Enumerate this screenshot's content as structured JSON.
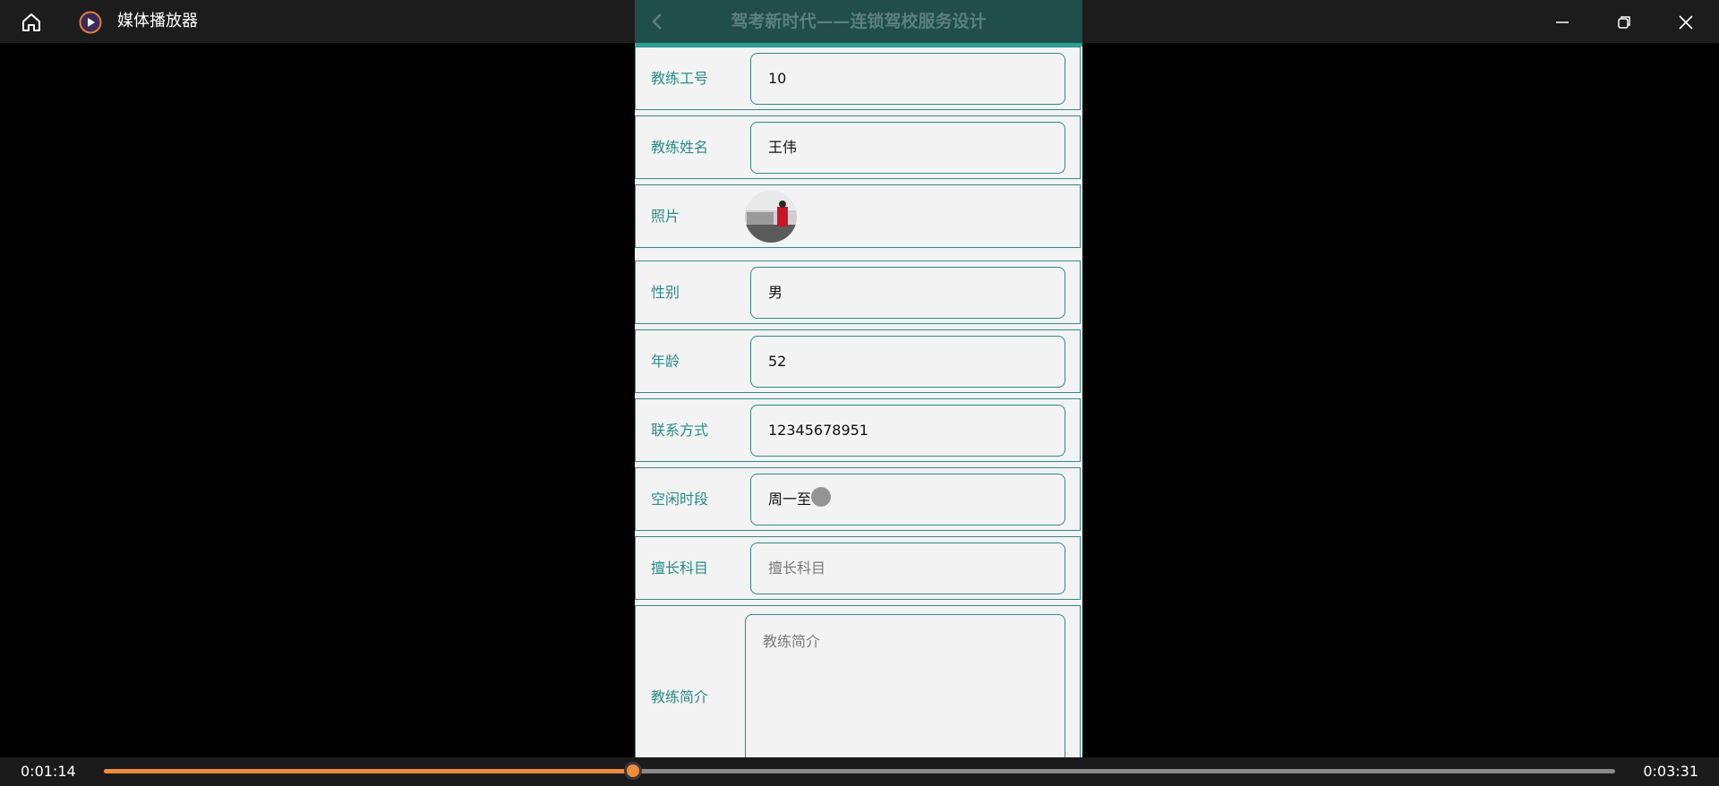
{
  "window": {
    "title": "媒体播放器",
    "icons": {
      "home": "home-icon",
      "app": "media-player-icon",
      "minimize": "minimize-icon",
      "maximize": "maximize-icon",
      "close": "close-icon"
    }
  },
  "app": {
    "header_title": "驾考新时代——连锁驾校服务设计",
    "back_icon": "back-chevron-icon",
    "colors": {
      "header_bg": "#1f4e4b",
      "accent": "#2aa198",
      "label": "#2a8c88"
    }
  },
  "form": {
    "coach_id": {
      "label": "教练工号",
      "value": "10"
    },
    "coach_name": {
      "label": "教练姓名",
      "value": "王伟"
    },
    "photo": {
      "label": "照片"
    },
    "gender": {
      "label": "性别",
      "value": "男"
    },
    "age": {
      "label": "年龄",
      "value": "52"
    },
    "contact": {
      "label": "联系方式",
      "value": "12345678951"
    },
    "free_time": {
      "label": "空闲时段",
      "value": "周一至"
    },
    "specialty": {
      "label": "擅长科目",
      "placeholder": "擅长科目"
    },
    "intro": {
      "label": "教练简介",
      "placeholder": "教练简介"
    }
  },
  "player": {
    "current_time": "0:01:14",
    "total_time": "0:03:31",
    "progress": 0.35,
    "accent_color": "#f08a3c"
  }
}
